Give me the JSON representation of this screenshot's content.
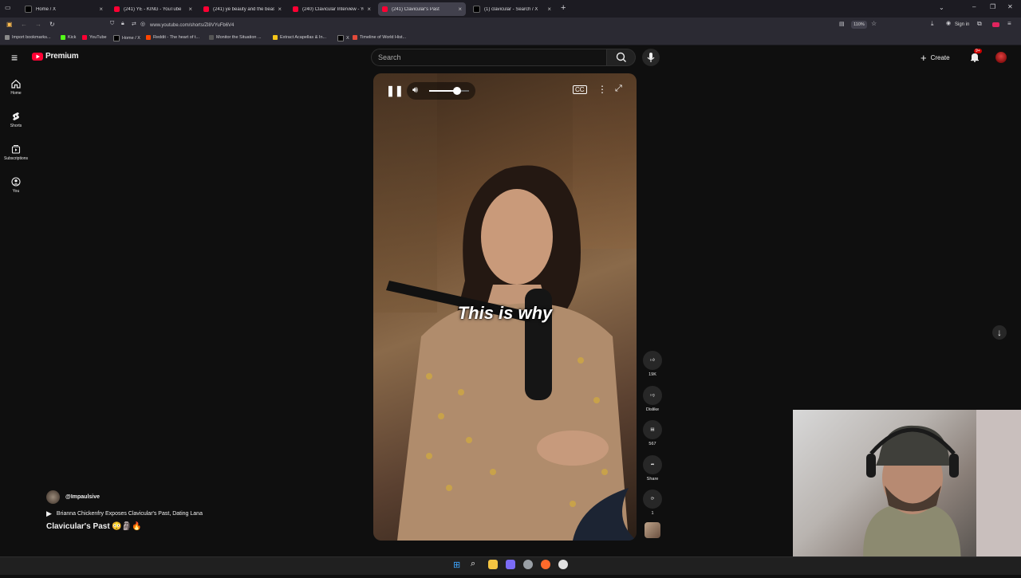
{
  "browser": {
    "tabs": [
      {
        "title": "Home / X",
        "color": "#000000",
        "active": false
      },
      {
        "title": "(241) YE - KING - YouTube",
        "color": "#ff0033",
        "active": false
      },
      {
        "title": "(241) ye beauty and the beast -",
        "color": "#ff0033",
        "active": false
      },
      {
        "title": "(240) Clavicular Interview - You",
        "color": "#ff0033",
        "active": false
      },
      {
        "title": "(241) Clavicular's Past",
        "color": "#ff0033",
        "active": true
      },
      {
        "title": "(1) clavicular - Search / X",
        "color": "#000000",
        "active": false
      }
    ],
    "new_tab": "+",
    "url": "www.youtube.com/shorts/Zl8VYuFb6V4",
    "zoom": "110%",
    "sign_in": "Sign in",
    "bookmarks": [
      {
        "label": "Import bookmarks...",
        "color": "#8a8a8a"
      },
      {
        "label": "Kick",
        "color": "#53fc18"
      },
      {
        "label": "YouTube",
        "color": "#ff0033"
      },
      {
        "label": "Home / X",
        "color": "#000000"
      },
      {
        "label": "Reddit - The heart of t...",
        "color": "#ff4500"
      },
      {
        "label": "Monitor the Situation ...",
        "color": "#555555"
      },
      {
        "label": "Extract Acapellas & In...",
        "color": "#f5c518"
      },
      {
        "label": "X",
        "color": "#000000"
      },
      {
        "label": "Timeline of World Hist...",
        "color": "#e24a3b"
      }
    ]
  },
  "youtube": {
    "brand": "Premium",
    "brand_color": "#ff0033",
    "search_placeholder": "Search",
    "create_label": "Create",
    "notif_count": "9+",
    "nav": [
      {
        "label": "Home",
        "icon": "home-icon"
      },
      {
        "label": "Shorts",
        "icon": "shorts-icon"
      },
      {
        "label": "Subscriptions",
        "icon": "subscriptions-icon"
      },
      {
        "label": "You",
        "icon": "you-icon"
      }
    ],
    "caption": "This is why",
    "actions": {
      "like_count": "19K",
      "dislike_label": "Dislike",
      "comment_count": "567",
      "share_label": "Share",
      "remix_count": "1"
    },
    "channel": "@Impaulsive",
    "playlist": "Brianna Chickenfry Exposes Clavicular's Past, Dating Lana",
    "title": "Clavicular's Past 😳🗿🔥",
    "volume_percent": 70
  }
}
